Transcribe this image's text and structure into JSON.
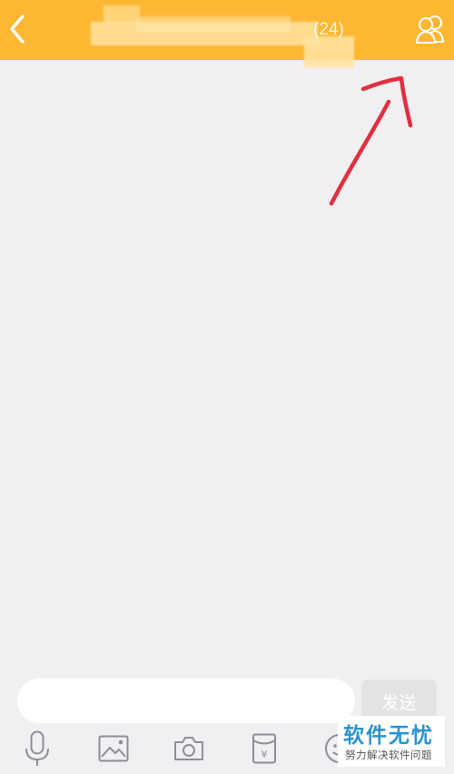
{
  "header": {
    "back_icon": "chevron-left-icon",
    "title_count": "(24)",
    "members_icon": "group-members-icon",
    "background_color": "#fdb733"
  },
  "annotation": {
    "arrow_color": "#e0303f"
  },
  "composer": {
    "input_value": "",
    "send_label": "发送"
  },
  "toolbar": {
    "items": [
      {
        "icon": "microphone-icon"
      },
      {
        "icon": "image-icon"
      },
      {
        "icon": "camera-icon"
      },
      {
        "icon": "red-packet-icon"
      },
      {
        "icon": "emoji-icon"
      }
    ]
  },
  "watermark": {
    "main": "软件无忧",
    "sub": "努力解决软件问题"
  }
}
